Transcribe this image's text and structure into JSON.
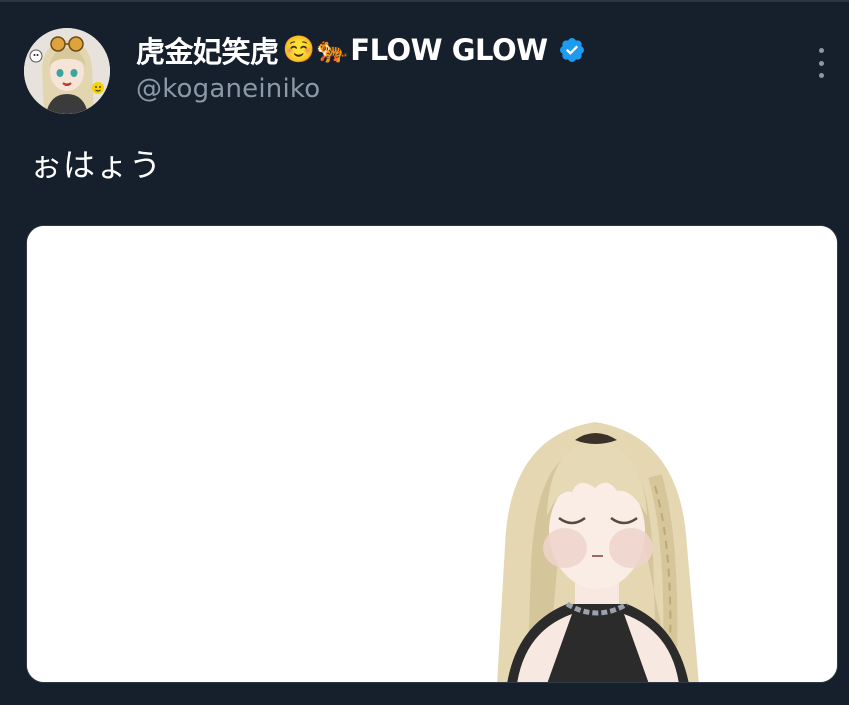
{
  "tweet": {
    "author": {
      "name_text": "虎金妃笑虎",
      "emoji_1": "☺️",
      "emoji_2": "🐅",
      "suffix": "FLOW GLOW",
      "handle": "@koganeiniko",
      "verified": true,
      "verified_icon": "verified-badge-icon",
      "avatar_icon": "avatar-image"
    },
    "text": "ぉはょう",
    "more_icon": "more-options-icon",
    "media": {
      "icon": "character-illustration-image"
    }
  },
  "colors": {
    "background": "#16202d",
    "name": "#ffffff",
    "handle": "#8b98a5",
    "verified": "#1d9bf0",
    "media_bg": "#ffffff"
  }
}
